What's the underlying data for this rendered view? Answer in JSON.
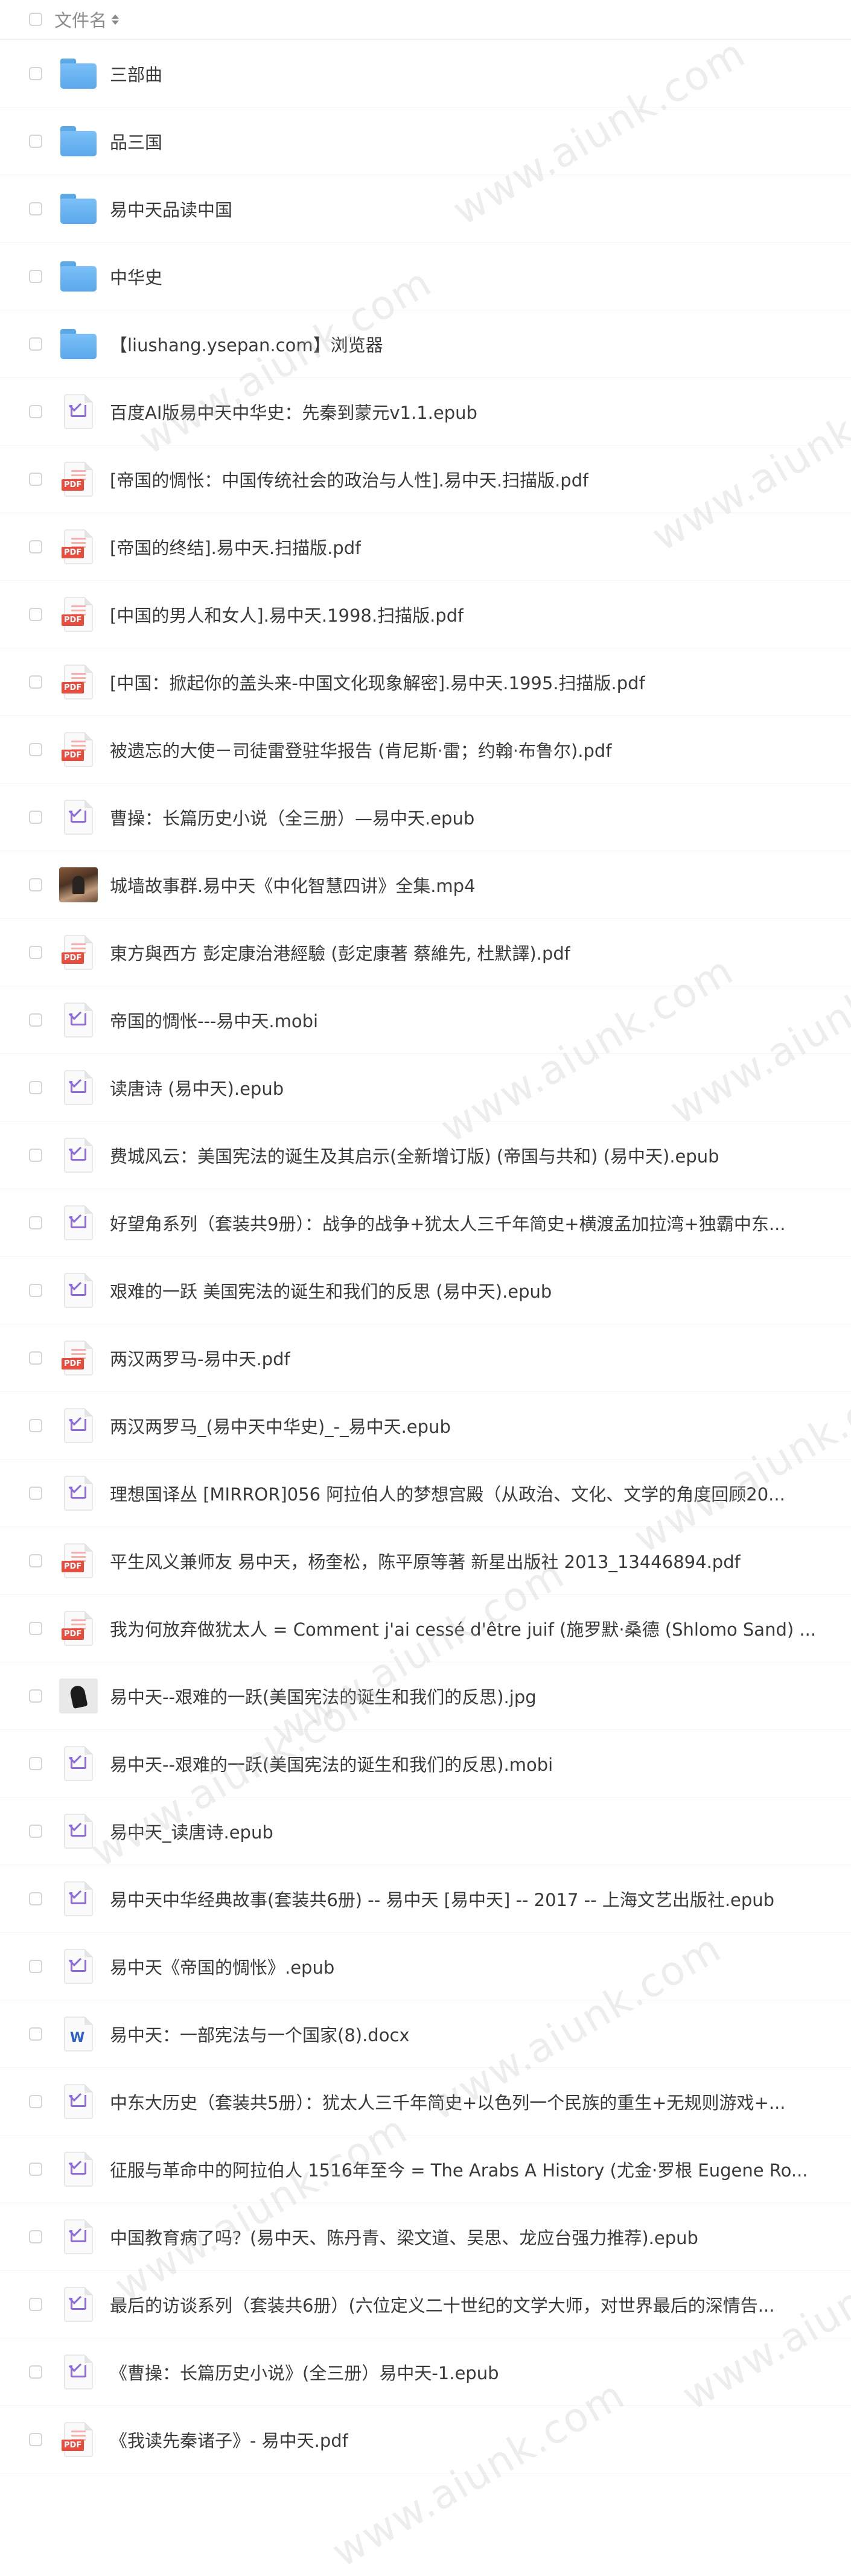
{
  "header": {
    "column_label": "文件名"
  },
  "watermark_text": "www.aiunk.com",
  "files": [
    {
      "name": "三部曲",
      "type": "folder"
    },
    {
      "name": "品三国",
      "type": "folder"
    },
    {
      "name": "易中天品读中国",
      "type": "folder"
    },
    {
      "name": "中华史",
      "type": "folder"
    },
    {
      "name": "【liushang.ysepan.com】浏览器",
      "type": "folder"
    },
    {
      "name": "百度AI版易中天中华史：先秦到蒙元v1.1.epub",
      "type": "ebook"
    },
    {
      "name": "[帝国的惆怅：中国传统社会的政治与人性].易中天.扫描版.pdf",
      "type": "pdf"
    },
    {
      "name": "[帝国的终结].易中天.扫描版.pdf",
      "type": "pdf"
    },
    {
      "name": "[中国的男人和女人].易中天.1998.扫描版.pdf",
      "type": "pdf"
    },
    {
      "name": "[中国：掀起你的盖头来-中国文化现象解密].易中天.1995.扫描版.pdf",
      "type": "pdf"
    },
    {
      "name": "被遗忘的大使－司徒雷登驻华报告 (肯尼斯·雷；约翰·布鲁尔).pdf",
      "type": "pdf"
    },
    {
      "name": "曹操：长篇历史小说（全三册）—易中天.epub",
      "type": "ebook"
    },
    {
      "name": "城墙故事群.易中天《中化智慧四讲》全集.mp4",
      "type": "video"
    },
    {
      "name": "東方與西方 彭定康治港經驗 (彭定康著 蔡維先, 杜默譯).pdf",
      "type": "pdf"
    },
    {
      "name": "帝国的惆怅---易中天.mobi",
      "type": "ebook"
    },
    {
      "name": "读唐诗 (易中天).epub",
      "type": "ebook"
    },
    {
      "name": "费城风云：美国宪法的诞生及其启示(全新增订版) (帝国与共和) (易中天).epub",
      "type": "ebook"
    },
    {
      "name": "好望角系列（套装共9册）：战争的战争+犹太人三千年简史+横渡孟加拉湾+独霸中东...",
      "type": "ebook"
    },
    {
      "name": "艰难的一跃 美国宪法的诞生和我们的反思 (易中天).epub",
      "type": "ebook"
    },
    {
      "name": "两汉两罗马-易中天.pdf",
      "type": "pdf"
    },
    {
      "name": "两汉两罗马_(易中天中华史)_-_易中天.epub",
      "type": "ebook"
    },
    {
      "name": "理想国译丛 [MIRROR]056 阿拉伯人的梦想宫殿（从政治、文化、文学的角度回顾20...",
      "type": "ebook"
    },
    {
      "name": "平生风义兼师友 易中天，杨奎松，陈平原等著 新星出版社 2013_13446894.pdf",
      "type": "pdf"
    },
    {
      "name": "我为何放弃做犹太人 = Comment j'ai cessé d'être juif (施罗默·桑德 (Shlomo Sand) ...",
      "type": "pdf"
    },
    {
      "name": "易中天--艰难的一跃(美国宪法的诞生和我们的反思).jpg",
      "type": "image"
    },
    {
      "name": "易中天--艰难的一跃(美国宪法的诞生和我们的反思).mobi",
      "type": "ebook"
    },
    {
      "name": "易中天_读唐诗.epub",
      "type": "ebook"
    },
    {
      "name": "易中天中华经典故事(套装共6册) -- 易中天 [易中天] -- 2017 -- 上海文艺出版社.epub",
      "type": "ebook"
    },
    {
      "name": "易中天《帝国的惆怅》.epub",
      "type": "ebook"
    },
    {
      "name": "易中天：一部宪法与一个国家(8).docx",
      "type": "word"
    },
    {
      "name": "中东大历史（套装共5册）：犹太人三千年简史+以色列一个民族的重生+无规则游戏+...",
      "type": "ebook"
    },
    {
      "name": "征服与革命中的阿拉伯人 1516年至今 = The Arabs A History (尤金·罗根 Eugene Ro...",
      "type": "ebook"
    },
    {
      "name": "中国教育病了吗？(易中天、陈丹青、梁文道、吴思、龙应台强力推荐).epub",
      "type": "ebook"
    },
    {
      "name": "最后的访谈系列（套装共6册）(六位定义二十世纪的文学大师，对世界最后的深情告...",
      "type": "ebook"
    },
    {
      "name": "《曹操：长篇历史小说》(全三册）易中天-1.epub",
      "type": "ebook"
    },
    {
      "name": "《我读先秦诸子》- 易中天.pdf",
      "type": "pdf"
    }
  ]
}
